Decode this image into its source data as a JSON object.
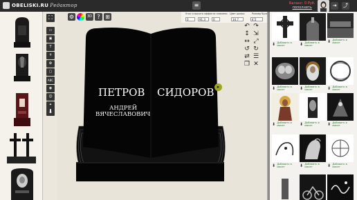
{
  "header": {
    "logo_main": "OBELISKI.RU",
    "logo_sub": "Редактор",
    "nav_icons": [
      "menu-icon",
      "folder-icon",
      "palette-icon",
      "3d-icon",
      "help-icon",
      "settings-icon"
    ],
    "balance_label": "Баланс: 0 Руб.",
    "topup_label": "пополнить",
    "right_icons": [
      "login-icon",
      "exit-icon"
    ]
  },
  "params": {
    "labels": [
      "Угол и высота эффекта пламени",
      "Цвет рамки",
      "Размер букв"
    ],
    "fields": [
      {
        "value": "0"
      },
      {
        "value": "91.3"
      },
      {
        "value": "0"
      },
      {
        "value": "34.7"
      },
      {
        "value": "4.5"
      }
    ]
  },
  "canvas": {
    "surname_1": "ПЕТРОВ",
    "surname_2": "СИДОРОВ",
    "name_1": "АНДРЕЙ",
    "patronymic_1": "ВЯЧЕСЛАВОВИЧ"
  },
  "tools": [
    "rect-tool",
    "image-tool",
    "text-tool",
    "cross-tool",
    "flower-tool",
    "frame-tool",
    "abc-tool",
    "photo-tool",
    "portrait-tool",
    "stamp-tool"
  ],
  "gallery": {
    "add_label": "Добавить в макет",
    "colors": {
      "accent": "#9ba626",
      "add": "#2b7a2b"
    }
  }
}
